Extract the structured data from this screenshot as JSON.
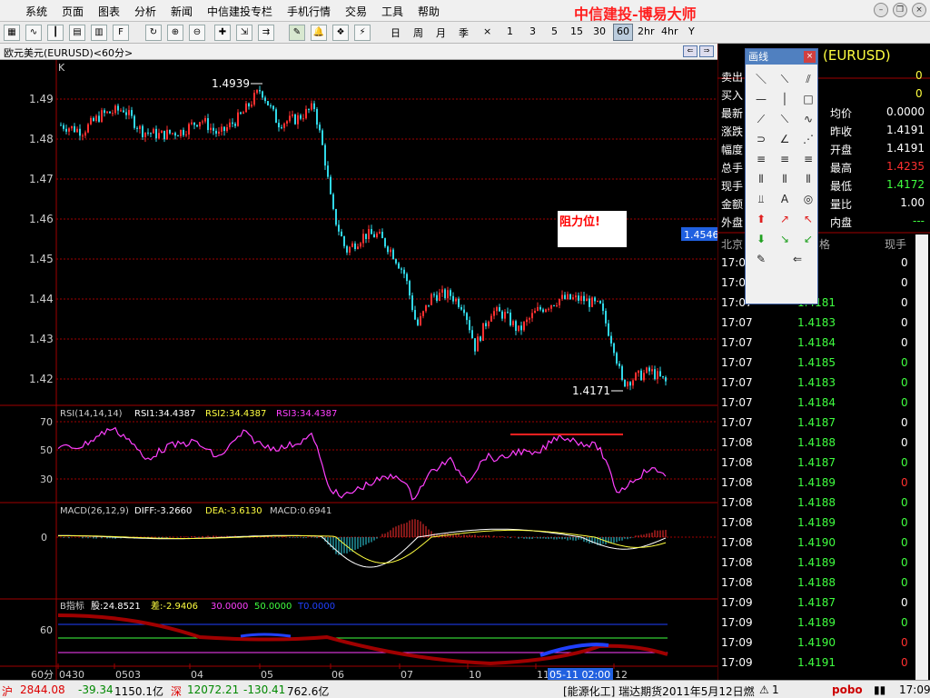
{
  "menu": {
    "items": [
      "系统",
      "页面",
      "图表",
      "分析",
      "新闻",
      "中信建投专栏",
      "手机行情",
      "交易",
      "工具",
      "帮助"
    ],
    "brand": "中信建投-博易大师"
  },
  "toolbar": {
    "periods": [
      "日",
      "周",
      "月",
      "季",
      "×",
      "1",
      "3",
      "5",
      "15",
      "30",
      "60",
      "2hr",
      "4hr",
      "Y"
    ],
    "selected_period": "60"
  },
  "chart": {
    "symbol_caption": "欧元美元(EURUSD)<60分>",
    "price_label": "K",
    "price_axis": [
      "1.49",
      "1.48",
      "1.47",
      "1.46",
      "1.45",
      "1.44",
      "1.43",
      "1.42"
    ],
    "high_label": "1.4939",
    "low_label": "1.4171",
    "current_tag": "1.4546",
    "annotation": "阻力位!",
    "x_ticks": [
      "0430",
      "0503",
      "04",
      "05",
      "06",
      "07",
      "10",
      "11",
      "12"
    ],
    "cursor_tag": "05-11 02:00",
    "period_label": "60分",
    "rsi": {
      "title": "RSI(14,14,14)",
      "l1": "RSI1:34.4387",
      "l2": "RSI2:34.4387",
      "l3": "RSI3:34.4387",
      "axis": [
        "70",
        "50",
        "30"
      ]
    },
    "macd": {
      "title": "MACD(26,12,9)",
      "diff": "DIFF:-3.2660",
      "dea": "DEA:-3.6130",
      "macd": "MACD:0.6941",
      "axis": [
        "0"
      ]
    },
    "b": {
      "title": "B指标",
      "v1": "股:24.8521",
      "v2": "差:-2.9406",
      "v3": "30.0000",
      "v4": "50.0000",
      "v5": "T0.0000",
      "axis": [
        "60"
      ]
    }
  },
  "panel": {
    "header": "(EURUSD)",
    "sell_label": "卖出",
    "sell_val": "0",
    "buy_label": "买入",
    "buy_val": "0",
    "rows": [
      {
        "l": "最新",
        "rl": "均价",
        "rv": "0.0000",
        "c": "#ffffff"
      },
      {
        "l": "涨跌",
        "rl": "昨收",
        "rv": "1.4191",
        "c": "#ffffff"
      },
      {
        "l": "幅度",
        "rl": "开盘",
        "rv": "1.4191",
        "c": "#ffffff"
      },
      {
        "l": "总手",
        "rl": "最高",
        "rv": "1.4235",
        "c": "#ff3030"
      },
      {
        "l": "现手",
        "rl": "最低",
        "rv": "1.4172",
        "c": "#40ff40"
      },
      {
        "l": "金额",
        "rl": "量比",
        "rv": "1.00",
        "c": "#ffffff"
      },
      {
        "l": "外盘",
        "rl": "内盘",
        "rv": "---",
        "c": "#40ff40"
      }
    ],
    "tick_head": {
      "time": "北京",
      "price": "格",
      "vol": "现手"
    },
    "ticks": [
      {
        "t": "17:07",
        "p": "79",
        "v": "0",
        "vc": "#fff"
      },
      {
        "t": "17:07",
        "p": "80",
        "v": "0",
        "vc": "#fff"
      },
      {
        "t": "17:07",
        "p": "1.4181",
        "v": "0",
        "vc": "#fff"
      },
      {
        "t": "17:07",
        "p": "1.4183",
        "v": "0",
        "vc": "#fff"
      },
      {
        "t": "17:07",
        "p": "1.4184",
        "v": "0",
        "vc": "#fff"
      },
      {
        "t": "17:07",
        "p": "1.4185",
        "v": "0",
        "vc": "#40ff40"
      },
      {
        "t": "17:07",
        "p": "1.4183",
        "v": "0",
        "vc": "#40ff40"
      },
      {
        "t": "17:07",
        "p": "1.4184",
        "v": "0",
        "vc": "#40ff40"
      },
      {
        "t": "17:07",
        "p": "1.4187",
        "v": "0",
        "vc": "#fff"
      },
      {
        "t": "17:08",
        "p": "1.4188",
        "v": "0",
        "vc": "#fff"
      },
      {
        "t": "17:08",
        "p": "1.4187",
        "v": "0",
        "vc": "#40ff40"
      },
      {
        "t": "17:08",
        "p": "1.4189",
        "v": "0",
        "vc": "#ff3030"
      },
      {
        "t": "17:08",
        "p": "1.4188",
        "v": "0",
        "vc": "#40ff40"
      },
      {
        "t": "17:08",
        "p": "1.4189",
        "v": "0",
        "vc": "#40ff40"
      },
      {
        "t": "17:08",
        "p": "1.4190",
        "v": "0",
        "vc": "#40ff40"
      },
      {
        "t": "17:08",
        "p": "1.4189",
        "v": "0",
        "vc": "#40ff40"
      },
      {
        "t": "17:08",
        "p": "1.4188",
        "v": "0",
        "vc": "#40ff40"
      },
      {
        "t": "17:09",
        "p": "1.4187",
        "v": "0",
        "vc": "#fff"
      },
      {
        "t": "17:09",
        "p": "1.4189",
        "v": "0",
        "vc": "#40ff40"
      },
      {
        "t": "17:09",
        "p": "1.4190",
        "v": "0",
        "vc": "#ff3030"
      },
      {
        "t": "17:09",
        "p": "1.4191",
        "v": "0",
        "vc": "#ff3030"
      }
    ]
  },
  "draw_tools": {
    "title": "画线",
    "tools": [
      "＼",
      "⟍",
      "⫽",
      "—",
      "│",
      "□",
      "⟋",
      "⟍",
      "∿",
      "⊃",
      "∠",
      "⋰",
      "≡",
      "≡",
      "≡",
      "⦀",
      "⦀",
      "⦀",
      "⫫",
      "A",
      "◎",
      "⬆",
      "↗",
      "↖",
      "⬇",
      "↘",
      "↙",
      "✎",
      "⇐"
    ]
  },
  "status": {
    "sh_label": "沪",
    "sh_val": "2844.08",
    "sh_chg": "-39.34",
    "sh_amt": "1150.1亿",
    "sz_label": "深",
    "sz_val": "12072.21",
    "sz_chg": "-130.41",
    "sz_amt": "762.6亿",
    "news": "[能源化工] 瑞达期货2011年5月12日燃",
    "alert": "1",
    "logo": "pobo",
    "clock": "17:09"
  },
  "colors": {
    "up": "#ff3030",
    "down": "#30d8e8",
    "grid": "#a00000",
    "rsi": "#ff40ff",
    "yellow": "#ffff40"
  }
}
